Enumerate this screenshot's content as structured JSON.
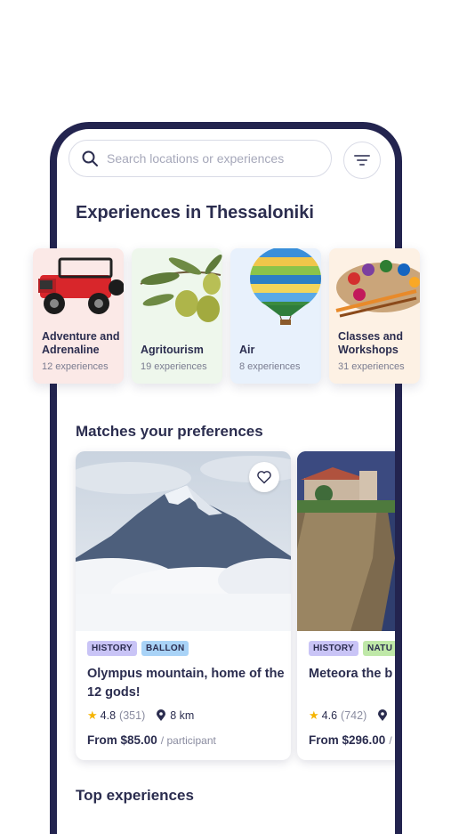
{
  "search": {
    "placeholder": "Search locations or experiences"
  },
  "page_title": "Experiences in Thessaloniki",
  "categories": [
    {
      "name": "Adventure and Adrenaline",
      "count": "12 experiences",
      "bg": "#fbe9e7"
    },
    {
      "name": "Agritourism",
      "count": "19 experiences",
      "bg": "#eef7ec"
    },
    {
      "name": "Air",
      "count": "8 experiences",
      "bg": "#e8f1fc"
    },
    {
      "name": "Classes and Workshops",
      "count": "31 experiences",
      "bg": "#fdf1e4"
    }
  ],
  "sections": {
    "matches": "Matches your preferences",
    "top": "Top experiences"
  },
  "cards": [
    {
      "tags": [
        {
          "label": "HISTORY",
          "color": "#c9c4f6"
        },
        {
          "label": "BALLON",
          "color": "#a9d3f7"
        }
      ],
      "title": "Olympus mountain, home of the 12 gods!",
      "rating": "4.8",
      "reviews": "(351)",
      "distance": "8 km",
      "price": "From $85.00",
      "per": "/ participant"
    },
    {
      "tags": [
        {
          "label": "HISTORY",
          "color": "#c9c4f6"
        },
        {
          "label": "NATU",
          "color": "#bfe8a8"
        }
      ],
      "title": "Meteora the b rocks!",
      "rating": "4.6",
      "reviews": "(742)",
      "distance": "",
      "price": "From $296.00",
      "per": "/"
    }
  ],
  "colors": {
    "frame": "#23244f",
    "text": "#2b2d4f",
    "star": "#f5b400"
  }
}
